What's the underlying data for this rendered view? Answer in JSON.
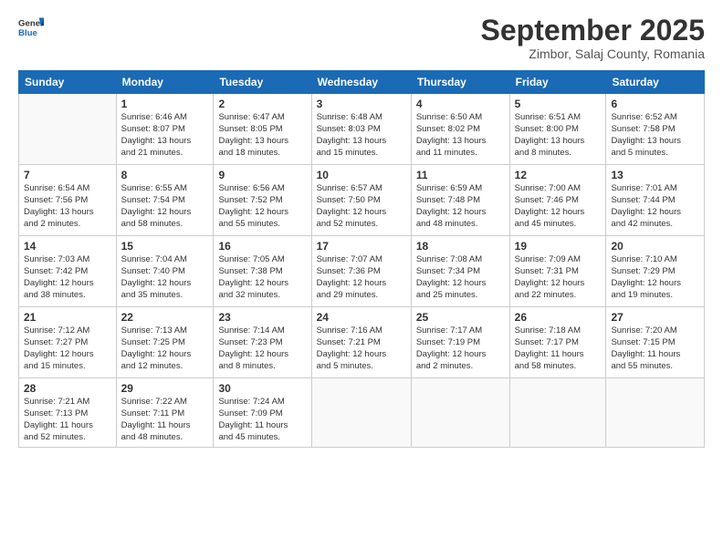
{
  "header": {
    "logo_general": "General",
    "logo_blue": "Blue",
    "month_title": "September 2025",
    "location": "Zimbor, Salaj County, Romania"
  },
  "weekdays": [
    "Sunday",
    "Monday",
    "Tuesday",
    "Wednesday",
    "Thursday",
    "Friday",
    "Saturday"
  ],
  "weeks": [
    [
      {
        "day": "",
        "info": ""
      },
      {
        "day": "1",
        "info": "Sunrise: 6:46 AM\nSunset: 8:07 PM\nDaylight: 13 hours\nand 21 minutes."
      },
      {
        "day": "2",
        "info": "Sunrise: 6:47 AM\nSunset: 8:05 PM\nDaylight: 13 hours\nand 18 minutes."
      },
      {
        "day": "3",
        "info": "Sunrise: 6:48 AM\nSunset: 8:03 PM\nDaylight: 13 hours\nand 15 minutes."
      },
      {
        "day": "4",
        "info": "Sunrise: 6:50 AM\nSunset: 8:02 PM\nDaylight: 13 hours\nand 11 minutes."
      },
      {
        "day": "5",
        "info": "Sunrise: 6:51 AM\nSunset: 8:00 PM\nDaylight: 13 hours\nand 8 minutes."
      },
      {
        "day": "6",
        "info": "Sunrise: 6:52 AM\nSunset: 7:58 PM\nDaylight: 13 hours\nand 5 minutes."
      }
    ],
    [
      {
        "day": "7",
        "info": "Sunrise: 6:54 AM\nSunset: 7:56 PM\nDaylight: 13 hours\nand 2 minutes."
      },
      {
        "day": "8",
        "info": "Sunrise: 6:55 AM\nSunset: 7:54 PM\nDaylight: 12 hours\nand 58 minutes."
      },
      {
        "day": "9",
        "info": "Sunrise: 6:56 AM\nSunset: 7:52 PM\nDaylight: 12 hours\nand 55 minutes."
      },
      {
        "day": "10",
        "info": "Sunrise: 6:57 AM\nSunset: 7:50 PM\nDaylight: 12 hours\nand 52 minutes."
      },
      {
        "day": "11",
        "info": "Sunrise: 6:59 AM\nSunset: 7:48 PM\nDaylight: 12 hours\nand 48 minutes."
      },
      {
        "day": "12",
        "info": "Sunrise: 7:00 AM\nSunset: 7:46 PM\nDaylight: 12 hours\nand 45 minutes."
      },
      {
        "day": "13",
        "info": "Sunrise: 7:01 AM\nSunset: 7:44 PM\nDaylight: 12 hours\nand 42 minutes."
      }
    ],
    [
      {
        "day": "14",
        "info": "Sunrise: 7:03 AM\nSunset: 7:42 PM\nDaylight: 12 hours\nand 38 minutes."
      },
      {
        "day": "15",
        "info": "Sunrise: 7:04 AM\nSunset: 7:40 PM\nDaylight: 12 hours\nand 35 minutes."
      },
      {
        "day": "16",
        "info": "Sunrise: 7:05 AM\nSunset: 7:38 PM\nDaylight: 12 hours\nand 32 minutes."
      },
      {
        "day": "17",
        "info": "Sunrise: 7:07 AM\nSunset: 7:36 PM\nDaylight: 12 hours\nand 29 minutes."
      },
      {
        "day": "18",
        "info": "Sunrise: 7:08 AM\nSunset: 7:34 PM\nDaylight: 12 hours\nand 25 minutes."
      },
      {
        "day": "19",
        "info": "Sunrise: 7:09 AM\nSunset: 7:31 PM\nDaylight: 12 hours\nand 22 minutes."
      },
      {
        "day": "20",
        "info": "Sunrise: 7:10 AM\nSunset: 7:29 PM\nDaylight: 12 hours\nand 19 minutes."
      }
    ],
    [
      {
        "day": "21",
        "info": "Sunrise: 7:12 AM\nSunset: 7:27 PM\nDaylight: 12 hours\nand 15 minutes."
      },
      {
        "day": "22",
        "info": "Sunrise: 7:13 AM\nSunset: 7:25 PM\nDaylight: 12 hours\nand 12 minutes."
      },
      {
        "day": "23",
        "info": "Sunrise: 7:14 AM\nSunset: 7:23 PM\nDaylight: 12 hours\nand 8 minutes."
      },
      {
        "day": "24",
        "info": "Sunrise: 7:16 AM\nSunset: 7:21 PM\nDaylight: 12 hours\nand 5 minutes."
      },
      {
        "day": "25",
        "info": "Sunrise: 7:17 AM\nSunset: 7:19 PM\nDaylight: 12 hours\nand 2 minutes."
      },
      {
        "day": "26",
        "info": "Sunrise: 7:18 AM\nSunset: 7:17 PM\nDaylight: 11 hours\nand 58 minutes."
      },
      {
        "day": "27",
        "info": "Sunrise: 7:20 AM\nSunset: 7:15 PM\nDaylight: 11 hours\nand 55 minutes."
      }
    ],
    [
      {
        "day": "28",
        "info": "Sunrise: 7:21 AM\nSunset: 7:13 PM\nDaylight: 11 hours\nand 52 minutes."
      },
      {
        "day": "29",
        "info": "Sunrise: 7:22 AM\nSunset: 7:11 PM\nDaylight: 11 hours\nand 48 minutes."
      },
      {
        "day": "30",
        "info": "Sunrise: 7:24 AM\nSunset: 7:09 PM\nDaylight: 11 hours\nand 45 minutes."
      },
      {
        "day": "",
        "info": ""
      },
      {
        "day": "",
        "info": ""
      },
      {
        "day": "",
        "info": ""
      },
      {
        "day": "",
        "info": ""
      }
    ]
  ]
}
